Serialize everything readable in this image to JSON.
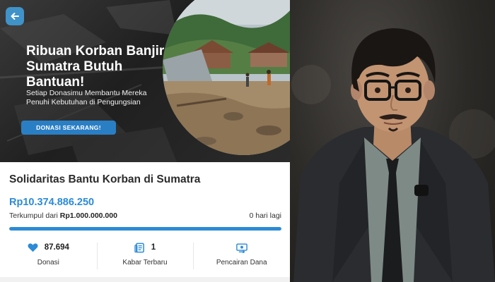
{
  "banner": {
    "headline": "Ribuan Korban Banjir Sumatra Butuh Bantuan!",
    "subline": "Setiap Donasimu Membantu Mereka Penuhi Kebutuhan di Pengungsian",
    "cta_label": "DONASI SEKARANG!"
  },
  "campaign": {
    "title": "Solidaritas Bantu Korban di Sumatra",
    "amount": "Rp10.374.886.250",
    "target_prefix": "Terkumpul dari",
    "target_amount": "Rp1.000.000.000",
    "days_left": "0 hari lagi",
    "progress_fraction": 1.0
  },
  "stats": [
    {
      "icon": "heart-icon",
      "value": "87.694",
      "label": "Donasi"
    },
    {
      "icon": "news-icon",
      "value": "1",
      "label": "Kabar Terbaru"
    },
    {
      "icon": "wallet-icon",
      "value": "",
      "label": "Pencairan Dana"
    }
  ],
  "colors": {
    "accent": "#2c8bd6",
    "cta": "#2a7fc4",
    "back_button": "#3f93c8"
  }
}
